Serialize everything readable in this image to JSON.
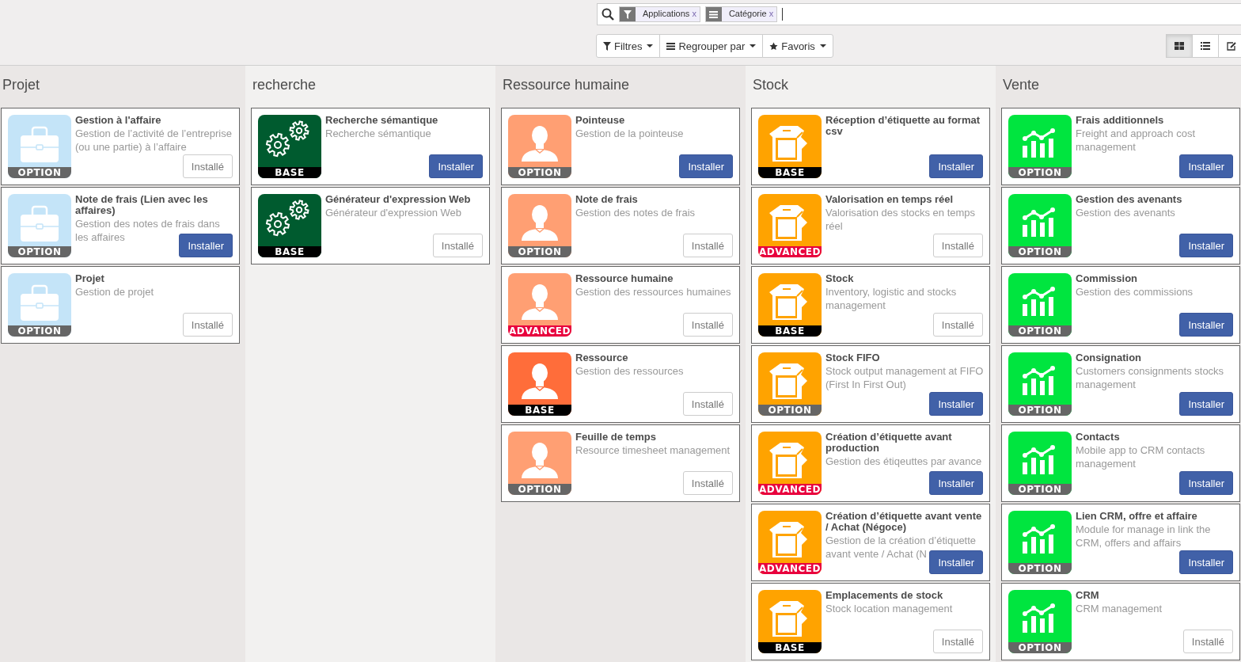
{
  "search": {
    "facets": [
      {
        "kind": "filter",
        "label": "Applications",
        "remove": "x"
      },
      {
        "kind": "groupby",
        "label": "Catégorie",
        "remove": "x"
      }
    ]
  },
  "buttons": [
    {
      "kind": "filter",
      "label": "Filtres"
    },
    {
      "kind": "groupby",
      "label": "Regrouper par"
    },
    {
      "kind": "favorite",
      "label": "Favoris"
    }
  ],
  "views": [
    {
      "kind": "kanban",
      "selected": true
    },
    {
      "kind": "list",
      "selected": false
    },
    {
      "kind": "edit",
      "selected": false
    }
  ],
  "columns": [
    {
      "title": "Projet",
      "apps": [
        {
          "name": "Gestion à l'affaire",
          "description": "Gestion de l’activité de l’entreprise (ou une partie) à l’affaire",
          "kind": "briefcase",
          "color": "#c4e4f8",
          "badge": {
            "label": "OPTION",
            "color": "#666666"
          },
          "installed": true,
          "button": "Installé"
        },
        {
          "name": "Note de frais (Lien avec les affaires)",
          "description": "Gestion des notes de frais dans les affaires",
          "kind": "briefcase",
          "color": "#c4e4f8",
          "badge": {
            "label": "OPTION",
            "color": "#666666"
          },
          "installed": false,
          "button": "Installer"
        },
        {
          "name": "Projet",
          "description": "Gestion de projet",
          "kind": "briefcase",
          "color": "#c4e4f8",
          "badge": {
            "label": "OPTION",
            "color": "#666666"
          },
          "installed": true,
          "button": "Installé"
        }
      ]
    },
    {
      "title": "recherche",
      "apps": [
        {
          "name": "Recherche sémantique",
          "description": "Recherche sémantique",
          "kind": "gears",
          "color": "#005b2f",
          "badge": {
            "label": "BASE",
            "color": "#000000"
          },
          "installed": false,
          "button": "Installer"
        },
        {
          "name": "Générateur d'expression Web",
          "description": "Générateur d'expression Web",
          "kind": "gears",
          "color": "#005b2f",
          "badge": {
            "label": "BASE",
            "color": "#000000"
          },
          "installed": true,
          "button": "Installé"
        }
      ]
    },
    {
      "title": "Ressource humaine",
      "apps": [
        {
          "name": "Pointeuse",
          "description": "Gestion de la pointeuse",
          "kind": "person",
          "color": "#ff9f73",
          "badge": {
            "label": "OPTION",
            "color": "#666666"
          },
          "installed": false,
          "button": "Installer"
        },
        {
          "name": "Note de frais",
          "description": "Gestion des notes de frais",
          "kind": "person",
          "color": "#ff9f73",
          "badge": {
            "label": "OPTION",
            "color": "#666666"
          },
          "installed": true,
          "button": "Installé"
        },
        {
          "name": "Ressource humaine",
          "description": "Gestion des ressources humaines",
          "kind": "person",
          "color": "#ff9f73",
          "badge": {
            "label": "ADVANCED",
            "color": "#e8003d"
          },
          "installed": true,
          "button": "Installé"
        },
        {
          "name": "Ressource",
          "description": "Gestion des ressources",
          "kind": "person",
          "color": "#ff6d3a",
          "badge": {
            "label": "BASE",
            "color": "#000000"
          },
          "installed": true,
          "button": "Installé"
        },
        {
          "name": "Feuille de temps",
          "description": "Resource timesheet management",
          "kind": "person",
          "color": "#ff9f73",
          "badge": {
            "label": "OPTION",
            "color": "#666666"
          },
          "installed": true,
          "button": "Installé"
        }
      ]
    },
    {
      "title": "Stock",
      "apps": [
        {
          "name": "Réception d’étiquette au format csv",
          "kind": "box",
          "color": "#ffa300",
          "badge": {
            "label": "BASE",
            "color": "#000000"
          },
          "installed": false,
          "button": "Installer"
        },
        {
          "name": "Valorisation en temps réel",
          "description": "Valorisation des stocks en temps réel",
          "kind": "box",
          "color": "#ffa300",
          "badge": {
            "label": "ADVANCED",
            "color": "#e8003d"
          },
          "installed": true,
          "button": "Installé"
        },
        {
          "name": "Stock",
          "description": "Inventory, logistic and stocks management",
          "kind": "box",
          "color": "#ffa300",
          "badge": {
            "label": "BASE",
            "color": "#000000"
          },
          "installed": true,
          "button": "Installé"
        },
        {
          "name": "Stock FIFO",
          "description": "Stock output management at FIFO (First In First Out)",
          "kind": "box",
          "color": "#ffa300",
          "badge": {
            "label": "OPTION",
            "color": "#666666"
          },
          "installed": false,
          "button": "Installer"
        },
        {
          "name": "Création d’étiquette avant production",
          "description": "Gestion des étiqeuttes par avance",
          "kind": "box",
          "color": "#ffa300",
          "badge": {
            "label": "ADVANCED",
            "color": "#e8003d"
          },
          "installed": false,
          "button": "Installer"
        },
        {
          "name": "Création d’étiquette avant vente / Achat (Négoce)",
          "description": "Gestion de la création d’étiquette avant vente / Achat (N",
          "kind": "box",
          "color": "#ffa300",
          "badge": {
            "label": "ADVANCED",
            "color": "#e8003d"
          },
          "installed": false,
          "button": "Installer"
        },
        {
          "name": "Emplacements de stock",
          "description": "Stock location management",
          "kind": "box",
          "color": "#ffa300",
          "badge": {
            "label": "BASE",
            "color": "#000000"
          },
          "installed": true,
          "button": "Installé"
        }
      ]
    },
    {
      "title": "Vente",
      "apps": [
        {
          "name": "Frais additionnels",
          "description": "Freight and approach cost management",
          "kind": "chart",
          "color": "#00e53f",
          "badge": {
            "label": "OPTION",
            "color": "#666666"
          },
          "installed": false,
          "button": "Installer"
        },
        {
          "name": "Gestion des avenants",
          "description": "Gestion des avenants",
          "kind": "chart",
          "color": "#00e53f",
          "badge": {
            "label": "OPTION",
            "color": "#666666"
          },
          "installed": false,
          "button": "Installer"
        },
        {
          "name": "Commission",
          "description": "Gestion des commissions",
          "kind": "chart",
          "color": "#00e53f",
          "badge": {
            "label": "OPTION",
            "color": "#666666"
          },
          "installed": false,
          "button": "Installer"
        },
        {
          "name": "Consignation",
          "description": "Customers consignments stocks management",
          "kind": "chart",
          "color": "#00e53f",
          "badge": {
            "label": "OPTION",
            "color": "#666666"
          },
          "installed": false,
          "button": "Installer"
        },
        {
          "name": "Contacts",
          "description": "Mobile app to CRM contacts management",
          "kind": "chart",
          "color": "#00e53f",
          "badge": {
            "label": "OPTION",
            "color": "#666666"
          },
          "installed": false,
          "button": "Installer"
        },
        {
          "name": "Lien CRM, offre et affaire",
          "description": "Module for manage in link the CRM, offers and affairs",
          "kind": "chart",
          "color": "#00e53f",
          "badge": {
            "label": "OPTION",
            "color": "#666666"
          },
          "installed": false,
          "button": "Installer"
        },
        {
          "name": "CRM",
          "description": "CRM management",
          "kind": "chart",
          "color": "#00e53f",
          "badge": {
            "label": "OPTION",
            "color": "#666666"
          },
          "installed": true,
          "button": "Installé"
        }
      ]
    }
  ]
}
